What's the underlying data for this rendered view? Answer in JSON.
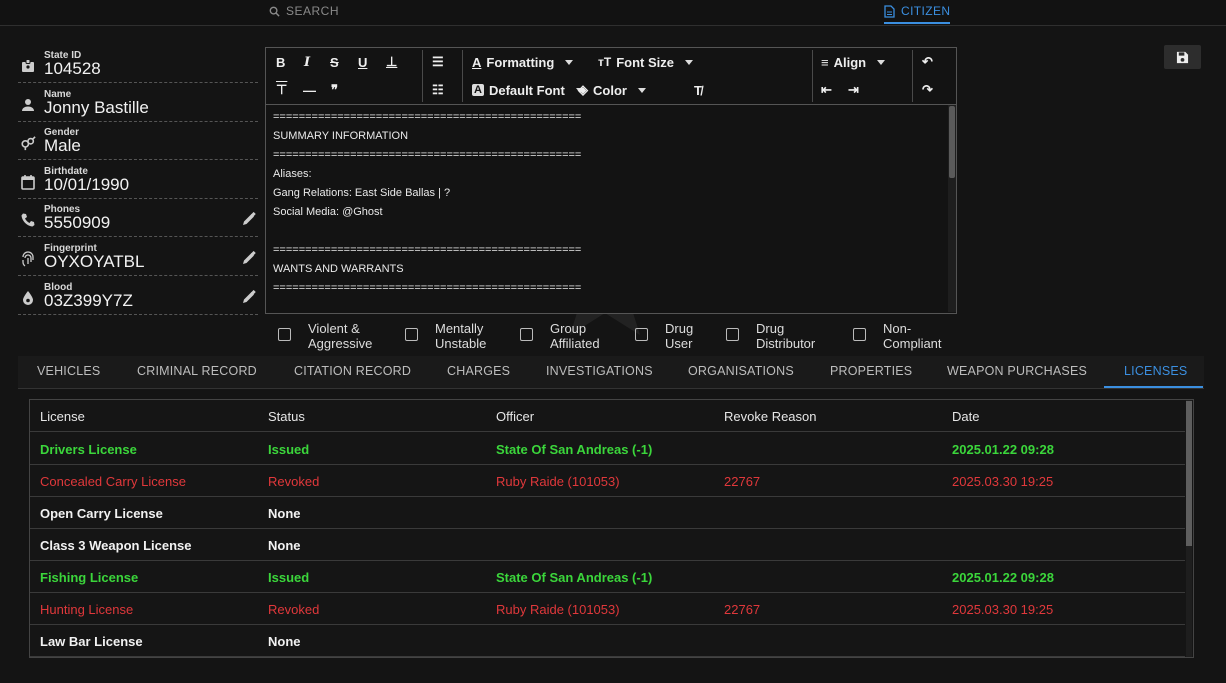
{
  "header": {
    "search_label": "SEARCH",
    "citizen_tab_label": "CITIZEN"
  },
  "profile": {
    "fields": [
      {
        "label": "State ID",
        "value": "104528",
        "icon": "id-badge-icon",
        "editable": false
      },
      {
        "label": "Name",
        "value": "Jonny Bastille",
        "icon": "person-icon",
        "editable": false
      },
      {
        "label": "Gender",
        "value": "Male",
        "icon": "gender-icon",
        "editable": false
      },
      {
        "label": "Birthdate",
        "value": "10/01/1990",
        "icon": "calendar-icon",
        "editable": false
      },
      {
        "label": "Phones",
        "value": "5550909",
        "icon": "phone-icon",
        "editable": true
      },
      {
        "label": "Fingerprint",
        "value": "OYXOYATBL",
        "icon": "fingerprint-icon",
        "editable": true
      },
      {
        "label": "Blood",
        "value": "03Z399Y7Z",
        "icon": "blood-drop-icon",
        "editable": true
      }
    ]
  },
  "editor": {
    "toolbar": {
      "formatting_label": "Formatting",
      "font_size_label": "Font Size",
      "default_font_label": "Default Font",
      "color_label": "Color",
      "align_label": "Align"
    },
    "lines": [
      "================================================",
      "SUMMARY INFORMATION",
      "================================================",
      "Aliases:",
      "Gang Relations: East Side Ballas | ?",
      "Social Media: @Ghost",
      "",
      "================================================",
      "WANTS AND WARRANTS",
      "================================================"
    ]
  },
  "flags": [
    {
      "line1": "Violent &",
      "line2": "Aggressive",
      "checked": false
    },
    {
      "line1": "Mentally",
      "line2": "Unstable",
      "checked": false
    },
    {
      "line1": "Group",
      "line2": "Affiliated",
      "checked": false
    },
    {
      "line1": "Drug",
      "line2": "User",
      "checked": false
    },
    {
      "line1": "Drug",
      "line2": "Distributor",
      "checked": false
    },
    {
      "line1": "Non-",
      "line2": "Compliant",
      "checked": false
    }
  ],
  "tabs": [
    {
      "label": "VEHICLES"
    },
    {
      "label": "CRIMINAL RECORD"
    },
    {
      "label": "CITATION RECORD"
    },
    {
      "label": "CHARGES"
    },
    {
      "label": "INVESTIGATIONS"
    },
    {
      "label": "ORGANISATIONS"
    },
    {
      "label": "PROPERTIES"
    },
    {
      "label": "WEAPON PURCHASES"
    },
    {
      "label": "LICENSES",
      "active": true
    }
  ],
  "licenses": {
    "columns": [
      "License",
      "Status",
      "Officer",
      "Revoke Reason",
      "Date"
    ],
    "rows": [
      {
        "license": "Drivers License",
        "status": "Issued",
        "officer": "State Of San Andreas (-1)",
        "reason": "",
        "date": "2025.01.22 09:28",
        "tone": "green"
      },
      {
        "license": "Concealed Carry License",
        "status": "Revoked",
        "officer": "Ruby Raide (101053)",
        "reason": "22767",
        "date": "2025.03.30 19:25",
        "tone": "red"
      },
      {
        "license": "Open Carry License",
        "status": "None",
        "officer": "",
        "reason": "",
        "date": "",
        "tone": "white"
      },
      {
        "license": "Class 3 Weapon License",
        "status": "None",
        "officer": "",
        "reason": "",
        "date": "",
        "tone": "white"
      },
      {
        "license": "Fishing License",
        "status": "Issued",
        "officer": "State Of San Andreas (-1)",
        "reason": "",
        "date": "2025.01.22 09:28",
        "tone": "green"
      },
      {
        "license": "Hunting License",
        "status": "Revoked",
        "officer": "Ruby Raide (101053)",
        "reason": "22767",
        "date": "2025.03.30 19:25",
        "tone": "red"
      },
      {
        "license": "Law Bar License",
        "status": "None",
        "officer": "",
        "reason": "",
        "date": "",
        "tone": "white"
      }
    ]
  },
  "colors": {
    "accent": "#3b8fe0",
    "issued": "#3bd63b",
    "revoked": "#e0383b"
  }
}
